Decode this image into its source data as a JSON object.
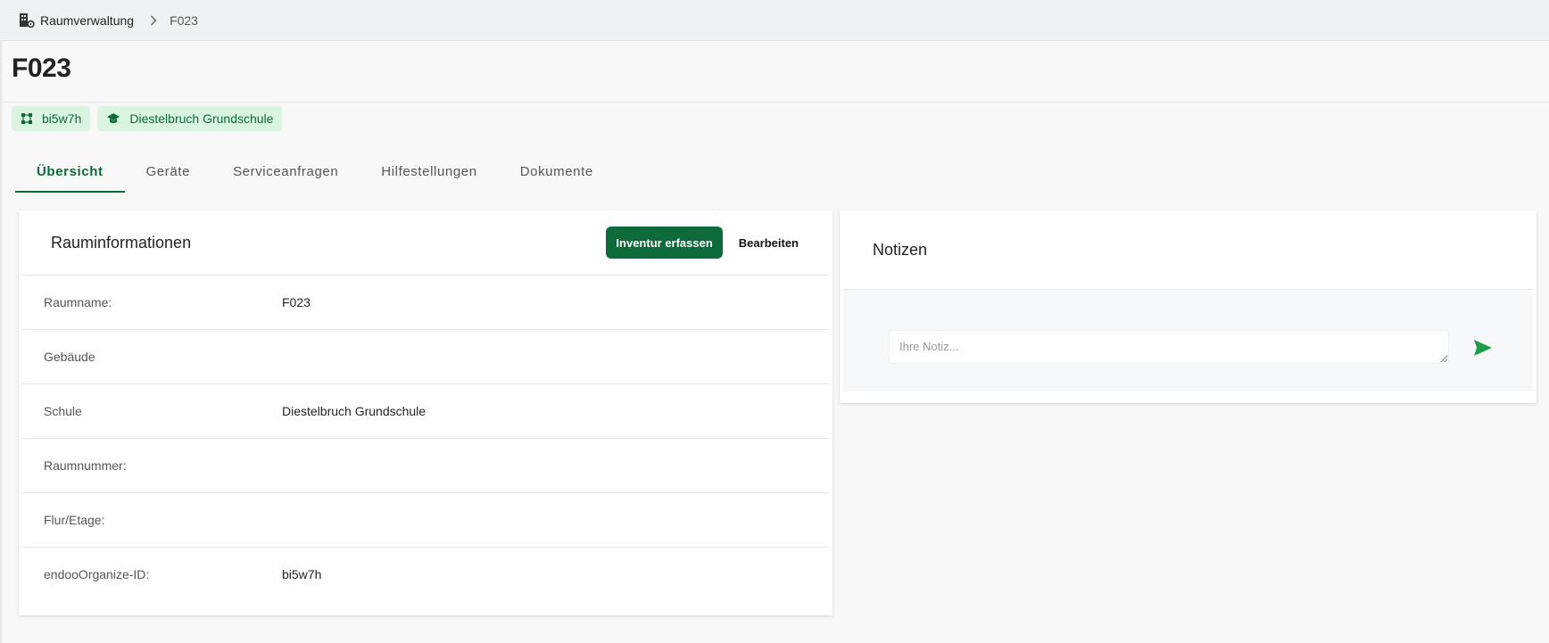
{
  "breadcrumb": {
    "root": "Raumverwaltung",
    "current": "F023"
  },
  "page": {
    "title": "F023"
  },
  "chips": [
    {
      "icon": "network-icon",
      "label": "bi5w7h"
    },
    {
      "icon": "school-cap-icon",
      "label": "Diestelbruch Grundschule"
    }
  ],
  "tabs": [
    {
      "label": "Übersicht",
      "active": true
    },
    {
      "label": "Geräte"
    },
    {
      "label": "Serviceanfragen"
    },
    {
      "label": "Hilfestellungen"
    },
    {
      "label": "Dokumente"
    }
  ],
  "info": {
    "title": "Rauminformationen",
    "inventory_button": "Inventur erfassen",
    "edit_button": "Bearbeiten",
    "rows": [
      {
        "label": "Raumname:",
        "value": "F023"
      },
      {
        "label": "Gebäude",
        "value": ""
      },
      {
        "label": "Schule",
        "value": "Diestelbruch Grundschule"
      },
      {
        "label": "Raumnummer:",
        "value": ""
      },
      {
        "label": "Flur/Etage:",
        "value": ""
      },
      {
        "label": "endooOrganize-ID:",
        "value": "bi5w7h"
      }
    ]
  },
  "notes": {
    "title": "Notizen",
    "placeholder": "Ihre Notiz...",
    "value": ""
  },
  "colors": {
    "accent": "#0d6b3a",
    "chip_bg": "#d9f5e2",
    "send": "#1e9e4a"
  }
}
